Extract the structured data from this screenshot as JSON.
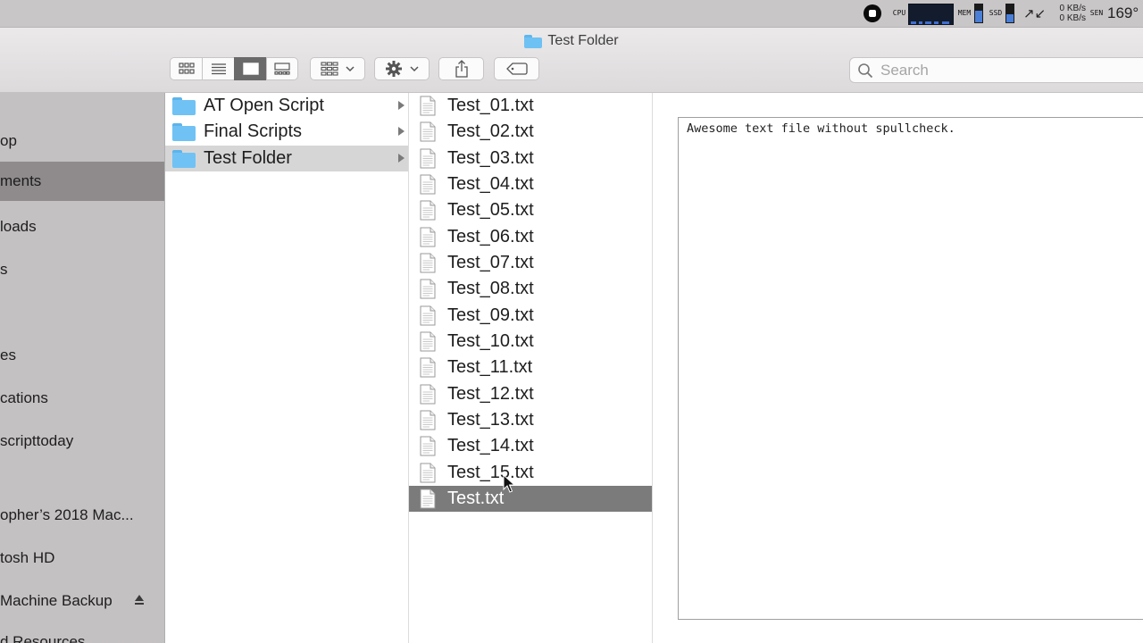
{
  "menubar": {
    "cpu_label": "CPU",
    "mem_label": "MEM",
    "ssd_label": "SSD",
    "sen_label": "SEN",
    "net_up": "0 KB/s",
    "net_down": "0 KB/s",
    "temperature": "169°"
  },
  "window": {
    "title": "Test Folder"
  },
  "search": {
    "placeholder": "Search"
  },
  "sidebar": {
    "items": [
      {
        "label": "op",
        "selected": false
      },
      {
        "label": "ments",
        "selected": true
      },
      {
        "label": "loads",
        "selected": false
      },
      {
        "label": "s",
        "selected": false
      },
      {
        "label": "",
        "selected": false
      },
      {
        "label": "es",
        "selected": false
      },
      {
        "label": "cations",
        "selected": false
      },
      {
        "label": "scripttoday",
        "selected": false
      },
      {
        "label": "opher’s 2018 Mac...",
        "selected": false
      },
      {
        "label": "tosh HD",
        "selected": false
      },
      {
        "label": "Machine Backup",
        "selected": false
      },
      {
        "label": "d Resources",
        "selected": false
      }
    ]
  },
  "column1": {
    "items": [
      {
        "label": "AT Open Script"
      },
      {
        "label": "Final Scripts"
      },
      {
        "label": "Test Folder"
      }
    ]
  },
  "column2": {
    "items": [
      {
        "label": "Test_01.txt"
      },
      {
        "label": "Test_02.txt"
      },
      {
        "label": "Test_03.txt"
      },
      {
        "label": "Test_04.txt"
      },
      {
        "label": "Test_05.txt"
      },
      {
        "label": "Test_06.txt"
      },
      {
        "label": "Test_07.txt"
      },
      {
        "label": "Test_08.txt"
      },
      {
        "label": "Test_09.txt"
      },
      {
        "label": "Test_10.txt"
      },
      {
        "label": "Test_11.txt"
      },
      {
        "label": "Test_12.txt"
      },
      {
        "label": "Test_13.txt"
      },
      {
        "label": "Test_14.txt"
      },
      {
        "label": "Test_15.txt"
      },
      {
        "label": "Test.txt"
      }
    ]
  },
  "preview": {
    "content": "Awesome text file without spullcheck."
  },
  "colors": {
    "sidebar_bg": "#c4c1c2",
    "sidebar_selected": "#8f8b8c",
    "row_selected_active": "#7b7b7b",
    "row_selected_inactive": "#d7d6d6",
    "folder_blue": "#70c2f4"
  }
}
